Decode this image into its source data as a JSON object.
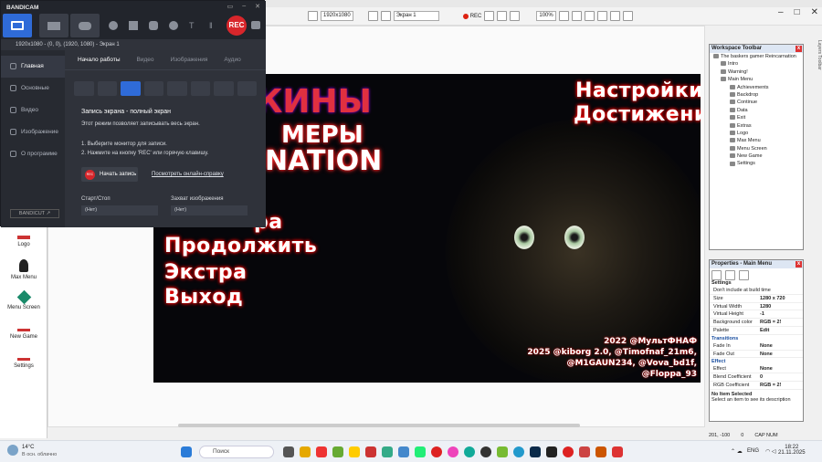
{
  "topbar": {
    "resolution": "1920x1080",
    "rec_label": "REC",
    "zoom": "100%"
  },
  "bandicam": {
    "brand": "BANDICAM",
    "rec_button": "REC",
    "target_line": "1920x1080 - (0, 0), (1920, 1080) - Экран 1",
    "nav": [
      "Главная",
      "Основные",
      "Видео",
      "Изображение",
      "О программе"
    ],
    "tabs": [
      "Начало работы",
      "Видео",
      "Изображения",
      "Аудио"
    ],
    "mode_title": "Запись экрана - полный экран",
    "mode_desc": "Этот режим позволяет записывать весь экран.",
    "step1": "1. Выберите монитор для записи.",
    "step2": "2. Нажмите на кнопку 'REC' или горячую клавишу.",
    "start_button": "Начать запись",
    "start_button_icon": "REC",
    "help_link": "Посмотреть онлайн-справку",
    "hotkey_start_label": "Старт/Стоп",
    "hotkey_start_value": "(Нет)",
    "hotkey_capture_label": "Захват изображения",
    "hotkey_capture_value": "(Нет)",
    "bandicut": "BANDICUT ↗"
  },
  "objects": [
    "Logo",
    "Max Menu",
    "Menu Screen",
    "New Game",
    "Settings"
  ],
  "game": {
    "title_line1": "КИНЫ",
    "title_line2": "МЕРЫ",
    "title_line3": "NATION",
    "top_right": [
      "Настройки",
      "Достижения"
    ],
    "menu": [
      "ра",
      "Продолжить",
      "Экстра",
      "Выход"
    ],
    "credits": [
      "2022 @МультФНАФ",
      "2025 @kiborg 2.0, @Timofnaf_21m6,",
      "@M1GAUN234, @Vova_bd1f,",
      "@Floppa_93"
    ]
  },
  "workspace": {
    "title": "Workspace Toolbar",
    "root": "The baskers gamer Reincarnation",
    "items": [
      "Intro",
      "Warning!",
      "Main Menu"
    ],
    "children": [
      "Achievements",
      "Backdrop",
      "Continue",
      "Data",
      "Exit",
      "Extras",
      "Logo",
      "Max Menu",
      "Menu Screen",
      "New Game",
      "Settings"
    ]
  },
  "properties": {
    "title": "Properties - Main Menu",
    "section": "Settings",
    "dont_include": "Don't include at build time",
    "rows": [
      {
        "k": "Size",
        "v": "1280 x 720"
      },
      {
        "k": "Virtual Width",
        "v": "1280"
      },
      {
        "k": "Virtual Height",
        "v": "-1"
      },
      {
        "k": "Background color",
        "v": "RGB = 2!"
      },
      {
        "k": "Palette",
        "v": "Edit"
      }
    ],
    "transitions": "Transitions",
    "trows": [
      {
        "k": "Fade In",
        "v": "None"
      },
      {
        "k": "Fade Out",
        "v": "None"
      }
    ],
    "effect_section": "Effect",
    "erows": [
      {
        "k": "Effect",
        "v": "None"
      },
      {
        "k": "Blend Coefficient",
        "v": "0"
      },
      {
        "k": "RGB Coefficient",
        "v": "RGB = 2!"
      }
    ],
    "no_item": "No Item Selected",
    "hint": "Select an item to see its description"
  },
  "sidetabs": "Layers Toolbar",
  "status": {
    "coords": "201, -100",
    "zero": "0",
    "caps": "CAP NUM"
  },
  "taskbar": {
    "temp": "14°C",
    "weather": "В осн. облачно",
    "search": "Поиск",
    "lang": "ENG",
    "time": "18:22",
    "date": "21.11.2025"
  }
}
